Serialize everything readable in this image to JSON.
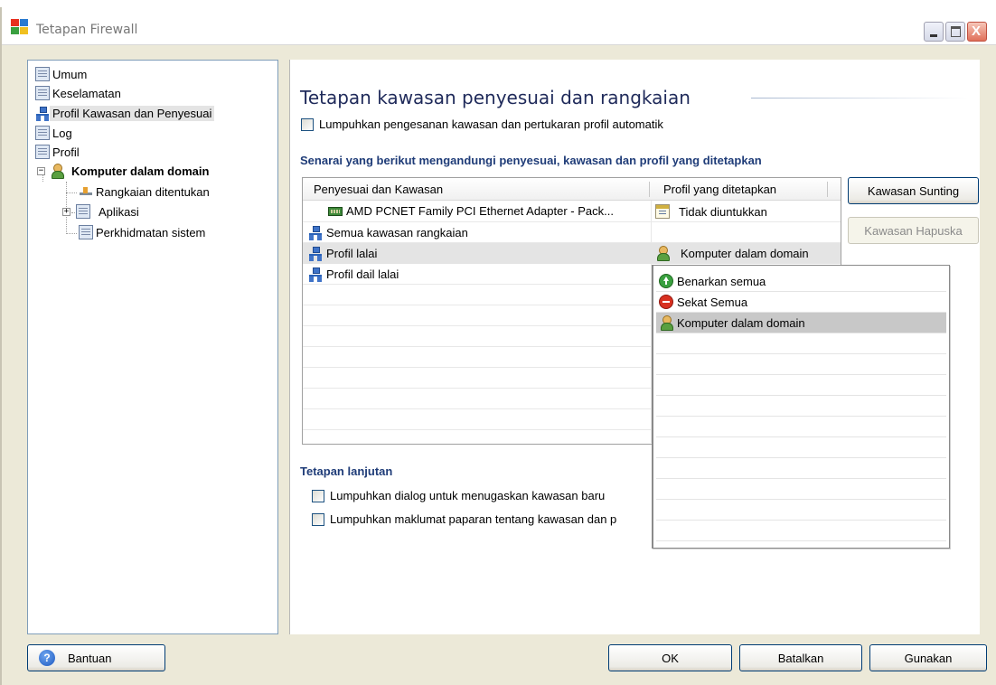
{
  "window": {
    "title": "Tetapan Firewall",
    "controls": {
      "minimize_icon": "minimize-icon",
      "maximize_icon": "maximize-icon",
      "close_icon": "close-icon",
      "close_glyph": "X"
    }
  },
  "tree": {
    "items": [
      {
        "label": "Umum",
        "icon": "document-icon"
      },
      {
        "label": "Keselamatan",
        "icon": "document-icon"
      },
      {
        "label": "Profil Kawasan dan Penyesuai",
        "icon": "network-icon",
        "selected": true
      },
      {
        "label": "Log",
        "icon": "document-icon"
      },
      {
        "label": "Profil",
        "icon": "document-icon"
      },
      {
        "label": "Komputer dalam domain",
        "icon": "user-icon",
        "bold": true,
        "expander": "−"
      },
      {
        "label": "Rangkaian ditentukan",
        "icon": "network-plan-icon"
      },
      {
        "label": "Aplikasi",
        "icon": "document-icon",
        "expander": "+"
      },
      {
        "label": "Perkhidmatan sistem",
        "icon": "document-icon"
      }
    ]
  },
  "main": {
    "heading": "Tetapan kawasan penyesuai dan rangkaian",
    "disable_detection_label": "Lumpuhkan pengesanan kawasan dan pertukaran profil automatik",
    "list_section_title": "Senarai yang berikut mengandungi penyesuai, kawasan dan profil yang ditetapkan",
    "list": {
      "columns": [
        "Penyesuai dan Kawasan",
        "Profil yang ditetapkan"
      ],
      "rows": [
        {
          "name": "AMD PCNET Family PCI Ethernet Adapter - Pack...",
          "profile": "Tidak diuntukkan",
          "icon": "network-card-icon",
          "profile_icon": "calendar-icon"
        },
        {
          "name": "Semua kawasan rangkaian",
          "profile": "",
          "icon": "network-icon"
        },
        {
          "name": "Profil lalai",
          "profile": "Komputer dalam domain",
          "icon": "network-icon",
          "profile_icon": "user-icon",
          "selected": true
        },
        {
          "name": "Profil dail lalai",
          "profile": "",
          "icon": "network-icon"
        }
      ]
    },
    "edit_zone_button": "Kawasan Sunting",
    "delete_zone_button": "Kawasan Hapuska",
    "advanced_title": "Tetapan lanjutan",
    "advanced_options": [
      "Lumpuhkan dialog untuk menugaskan kawasan baru",
      "Lumpuhkan maklumat paparan tentang kawasan dan p"
    ],
    "profile_dropdown": {
      "options": [
        {
          "label": "Benarkan semua",
          "icon": "allow-icon"
        },
        {
          "label": "Sekat Semua",
          "icon": "block-icon"
        },
        {
          "label": "Komputer dalam domain",
          "icon": "user-icon",
          "selected": true
        }
      ]
    }
  },
  "footer": {
    "help_button": "Bantuan",
    "help_glyph": "?",
    "ok_button": "OK",
    "cancel_button": "Batalkan",
    "apply_button": "Gunakan"
  },
  "colors": {
    "heading": "#1f2a5a",
    "section_title": "#1f3c78",
    "selection": "#e4e4e4",
    "dropdown_selection": "#c8c8c8"
  }
}
